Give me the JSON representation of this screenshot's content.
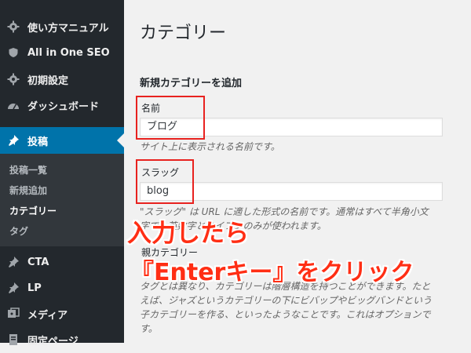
{
  "sidebar": {
    "top_items": [
      {
        "label": "使い方マニュアル",
        "icon": "gear-icon"
      },
      {
        "label": "All in One SEO",
        "icon": "shield-icon"
      },
      {
        "label": "初期設定",
        "icon": "gear-icon"
      },
      {
        "label": "ダッシュボード",
        "icon": "dashboard-icon"
      }
    ],
    "active_item": {
      "label": "投稿",
      "icon": "pin-icon"
    },
    "submenu": [
      {
        "label": "投稿一覧"
      },
      {
        "label": "新規追加"
      },
      {
        "label": "カテゴリー"
      },
      {
        "label": "タグ"
      }
    ],
    "bottom_items": [
      {
        "label": "CTA",
        "icon": "pin-icon"
      },
      {
        "label": "LP",
        "icon": "pin-icon"
      },
      {
        "label": "メディア",
        "icon": "media-icon"
      },
      {
        "label": "固定ページ",
        "icon": "page-icon"
      }
    ]
  },
  "main": {
    "page_title": "カテゴリー",
    "section_title": "新規カテゴリーを追加",
    "name_label": "名前",
    "name_value": "ブログ",
    "name_desc": "サイト上に表示される名前です。",
    "slug_label": "スラッグ",
    "slug_value": "blog",
    "slug_desc_1": "\"スラッグ\" は URL に適した形式の名前です。通常はすべて半角小文",
    "slug_desc_2": "字で、英数字とハイフンのみが使われます。",
    "parent_label": "親カテゴリー",
    "parent_desc_1": "タグとは異なり、カテゴリーは階層構造を持つことができます。たと",
    "parent_desc_2": "えば、ジャズというカテゴリーの下にビバップやビッグバンドという",
    "parent_desc_3": "子カテゴリーを作る、といったようなことです。これはオプションで",
    "parent_desc_4": "す。"
  },
  "annotation": {
    "line1": "入力したら",
    "line2": "『Enterキー』をクリック",
    "color": "#ff2e14"
  },
  "colors": {
    "sidebar_bg": "#23282d",
    "submenu_bg": "#32373c",
    "active_bg": "#0073aa",
    "highlight": "#e8221f"
  }
}
